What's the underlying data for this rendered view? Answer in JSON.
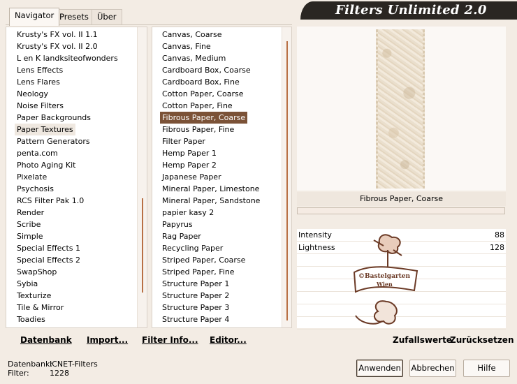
{
  "title": "Filters Unlimited 2.0",
  "tabs": [
    {
      "label": "Navigator"
    },
    {
      "label": "Presets"
    },
    {
      "label": "Über"
    }
  ],
  "categories": [
    {
      "label": "Krusty's FX vol. II 1.1"
    },
    {
      "label": "Krusty's FX vol. II 2.0"
    },
    {
      "label": "L en K landksiteofwonders"
    },
    {
      "label": "Lens Effects"
    },
    {
      "label": "Lens Flares"
    },
    {
      "label": "Neology"
    },
    {
      "label": "Noise Filters"
    },
    {
      "label": "Paper Backgrounds"
    },
    {
      "label": "Paper Textures"
    },
    {
      "label": "Pattern Generators"
    },
    {
      "label": "penta.com"
    },
    {
      "label": "Photo Aging Kit"
    },
    {
      "label": "Pixelate"
    },
    {
      "label": "Psychosis"
    },
    {
      "label": "RCS Filter Pak 1.0"
    },
    {
      "label": "Render"
    },
    {
      "label": "Scribe"
    },
    {
      "label": "Simple"
    },
    {
      "label": "Special Effects 1"
    },
    {
      "label": "Special Effects 2"
    },
    {
      "label": "SwapShop"
    },
    {
      "label": "Sybia"
    },
    {
      "label": "Texturize"
    },
    {
      "label": "Tile & Mirror"
    },
    {
      "label": "Toadies"
    }
  ],
  "selected_category": "Paper Textures",
  "filters": [
    {
      "label": "Canvas, Coarse"
    },
    {
      "label": "Canvas, Fine"
    },
    {
      "label": "Canvas, Medium"
    },
    {
      "label": "Cardboard Box, Coarse"
    },
    {
      "label": "Cardboard Box, Fine"
    },
    {
      "label": "Cotton Paper, Coarse"
    },
    {
      "label": "Cotton Paper, Fine"
    },
    {
      "label": "Fibrous Paper, Coarse"
    },
    {
      "label": "Fibrous Paper, Fine"
    },
    {
      "label": "Filter Paper"
    },
    {
      "label": "Hemp Paper 1"
    },
    {
      "label": "Hemp Paper 2"
    },
    {
      "label": "Japanese Paper"
    },
    {
      "label": "Mineral Paper, Limestone"
    },
    {
      "label": "Mineral Paper, Sandstone"
    },
    {
      "label": "papier kasy 2"
    },
    {
      "label": "Papyrus"
    },
    {
      "label": "Rag Paper"
    },
    {
      "label": "Recycling Paper"
    },
    {
      "label": "Striped Paper, Coarse"
    },
    {
      "label": "Striped Paper, Fine"
    },
    {
      "label": "Structure Paper 1"
    },
    {
      "label": "Structure Paper 2"
    },
    {
      "label": "Structure Paper 3"
    },
    {
      "label": "Structure Paper 4"
    }
  ],
  "selected_filter": "Fibrous Paper, Coarse",
  "preview": {
    "filter_name": "Fibrous Paper, Coarse",
    "watermark_text_1": "©Bastelgarten",
    "watermark_text_2": "Wien"
  },
  "params": [
    {
      "label": "Intensity",
      "value": "88"
    },
    {
      "label": "Lightness",
      "value": "128"
    },
    {
      "label": "",
      "value": ""
    },
    {
      "label": "",
      "value": ""
    },
    {
      "label": "",
      "value": ""
    },
    {
      "label": "",
      "value": ""
    },
    {
      "label": "",
      "value": ""
    },
    {
      "label": "",
      "value": ""
    }
  ],
  "toolbar": {
    "datenbank": "Datenbank",
    "import": "Import...",
    "filter_info": "Filter Info...",
    "editor": "Editor...",
    "zufallswerte": "Zufallswerte",
    "zuruecksetzen": "Zurücksetzen"
  },
  "status": {
    "db_label": "Datenbank:",
    "db_value": "ICNET-Filters",
    "filter_label": "Filter:",
    "filter_value": "1228"
  },
  "buttons": {
    "apply": "Anwenden",
    "cancel": "Abbrechen",
    "help": "Hilfe"
  },
  "colors": {
    "accent": "#7b5237",
    "window_bg": "#f3ece4",
    "banner_bg": "#2a2622"
  }
}
